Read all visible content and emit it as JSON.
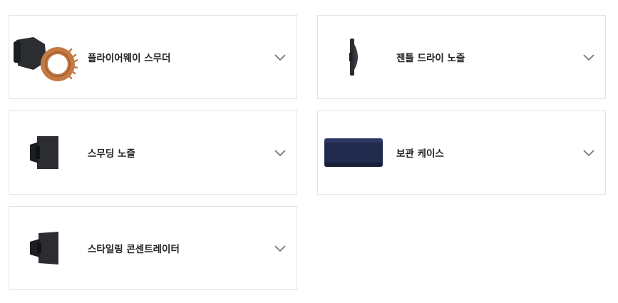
{
  "accessories": [
    {
      "label": "플라이어웨이 스무더",
      "icon": "flyaway-smoother-icon"
    },
    {
      "label": "젠틀 드라이 노즐",
      "icon": "gentle-dry-nozzle-icon"
    },
    {
      "label": "스무딩 노즐",
      "icon": "smoothing-nozzle-icon"
    },
    {
      "label": "보관 케이스",
      "icon": "storage-case-icon"
    },
    {
      "label": "스타일링 콘센트레이터",
      "icon": "styling-concentrator-icon"
    }
  ],
  "colors": {
    "border": "#e2e2e2",
    "text": "#222222",
    "chevron": "#777777",
    "copper": "#c47a45",
    "graphite": "#2b2d31",
    "navy": "#1f2a4d"
  }
}
